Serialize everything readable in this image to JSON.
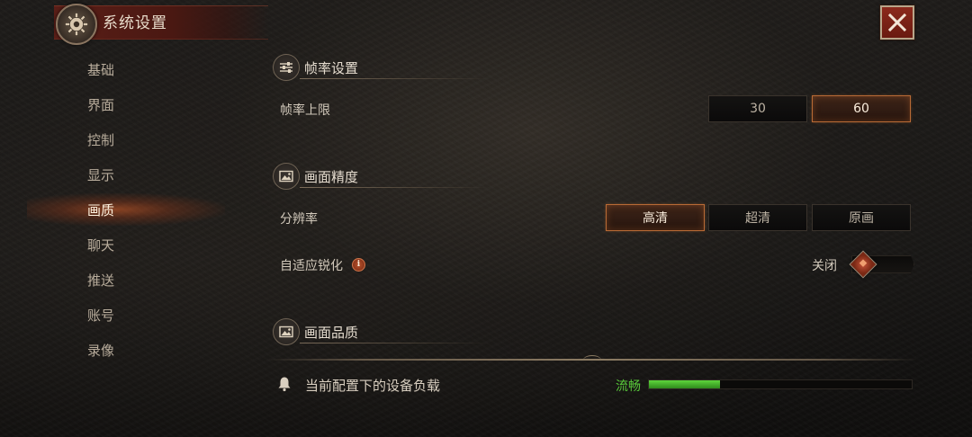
{
  "window": {
    "title": "系统设置",
    "close_icon": "close-icon"
  },
  "sidebar": {
    "items": [
      {
        "label": "基础"
      },
      {
        "label": "界面"
      },
      {
        "label": "控制"
      },
      {
        "label": "显示"
      },
      {
        "label": "画质"
      },
      {
        "label": "聊天"
      },
      {
        "label": "推送"
      },
      {
        "label": "账号"
      },
      {
        "label": "录像"
      }
    ],
    "active_index": 4
  },
  "sections": {
    "framerate": {
      "title": "帧率设置",
      "icon": "sliders-icon",
      "limit_label": "帧率上限",
      "options": [
        "30",
        "60"
      ],
      "selected": "60"
    },
    "precision": {
      "title": "画面精度",
      "icon": "picture-icon",
      "resolution_label": "分辨率",
      "options": [
        "高清",
        "超清",
        "原画"
      ],
      "selected": "高清",
      "sharpen_label": "自适应锐化",
      "sharpen_info": "i",
      "sharpen_value": "关闭",
      "sharpen_on": false
    },
    "quality": {
      "title": "画面品质",
      "icon": "picture-icon"
    }
  },
  "device_load": {
    "label": "当前配置下的设备负载",
    "status": "流畅",
    "status_color": "#58c83a",
    "level": 0.27
  },
  "colors": {
    "accent": "#b86a35",
    "close_button": "#8c2a1c",
    "active_glow": "#dc5f28"
  }
}
